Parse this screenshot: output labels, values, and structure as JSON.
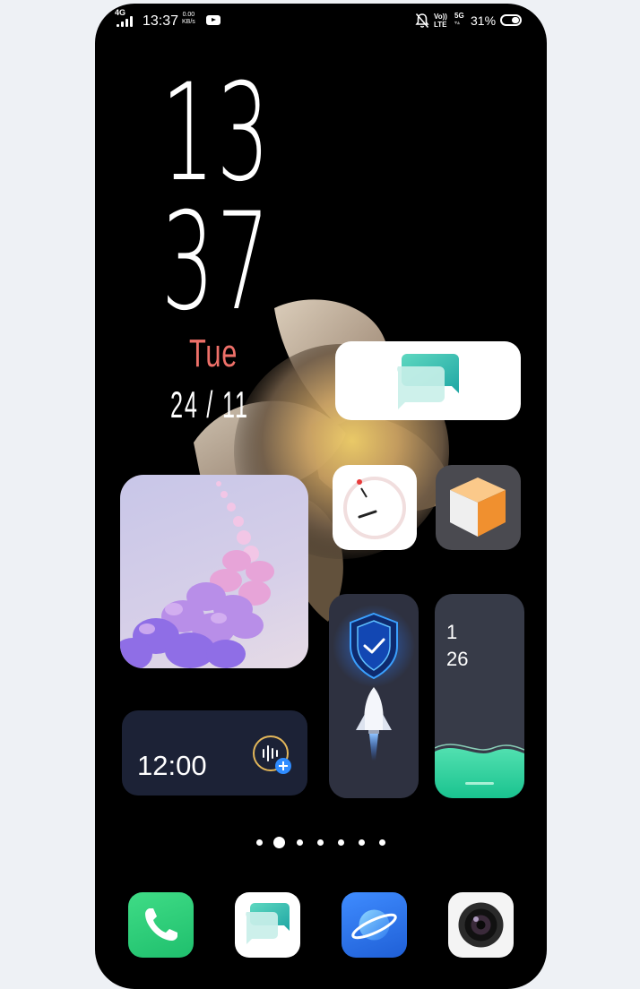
{
  "status_bar": {
    "network_type": "4G",
    "time": "13:37",
    "speed_value": "0.00",
    "speed_unit": "KB/s",
    "volte_top": "Vo))",
    "volte_bottom": "LTE",
    "five_g": "5G",
    "battery_percent": "31%"
  },
  "lock_clock": {
    "hour": "13",
    "minute": "37",
    "day_of_week": "Tue",
    "date": "24 / 11"
  },
  "widgets": {
    "alarm_time": "12:00",
    "steps_line1": "1",
    "steps_line2": "26"
  },
  "page_indicator": {
    "count": 7,
    "active_index": 1
  },
  "dock": [
    "phone-app",
    "messages-app",
    "browser-app",
    "camera-app"
  ],
  "colors": {
    "day_of_week": "#ee7069",
    "phone_green": "#2ecc71",
    "browser_blue": "#2e7bf0",
    "security_blue": "#2f7bff"
  }
}
